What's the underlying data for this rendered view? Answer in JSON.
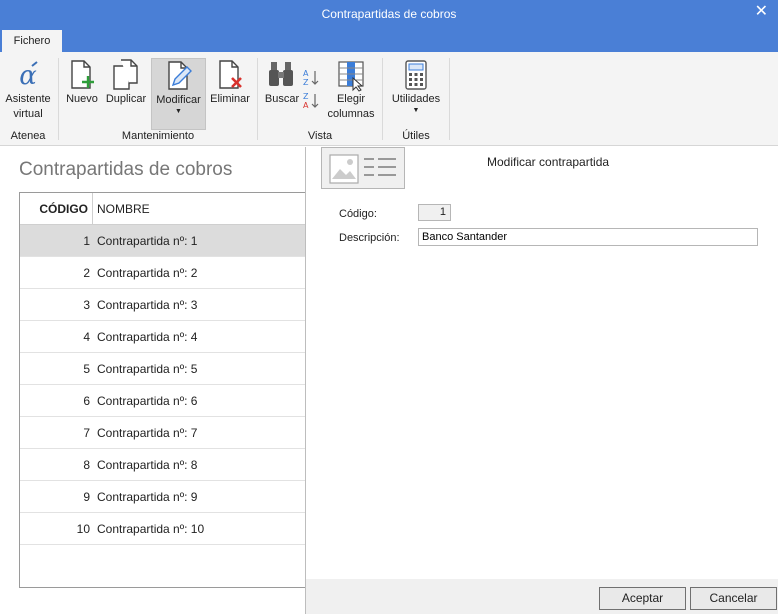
{
  "window": {
    "title": "Contrapartidas de cobros",
    "close_glyph": "✕"
  },
  "tabs": [
    {
      "label": "Fichero"
    }
  ],
  "ribbon": {
    "atenea": {
      "label": "Atenea",
      "asistente": "Asistente\nvirtual"
    },
    "mantenimiento": {
      "label": "Mantenimiento",
      "nuevo": "Nuevo",
      "duplicar": "Duplicar",
      "modificar": "Modificar",
      "eliminar": "Eliminar"
    },
    "vista": {
      "label": "Vista",
      "buscar": "Buscar",
      "elegir": "Elegir\ncolumnas"
    },
    "utiles": {
      "label": "Útiles",
      "utilidades": "Utilidades"
    }
  },
  "list": {
    "title": "Contrapartidas de cobros",
    "columns": {
      "code": "CÓDIGO",
      "name": "NOMBRE"
    },
    "rows": [
      {
        "code": "1",
        "name": "Contrapartida nº: 1"
      },
      {
        "code": "2",
        "name": "Contrapartida nº: 2"
      },
      {
        "code": "3",
        "name": "Contrapartida nº: 3"
      },
      {
        "code": "4",
        "name": "Contrapartida nº: 4"
      },
      {
        "code": "5",
        "name": "Contrapartida nº: 5"
      },
      {
        "code": "6",
        "name": "Contrapartida nº: 6"
      },
      {
        "code": "7",
        "name": "Contrapartida nº: 7"
      },
      {
        "code": "8",
        "name": "Contrapartida nº: 8"
      },
      {
        "code": "9",
        "name": "Contrapartida nº: 9"
      },
      {
        "code": "10",
        "name": "Contrapartida nº: 10"
      }
    ],
    "selected_index": 0
  },
  "form": {
    "title": "Modificar contrapartida",
    "code_label": "Código:",
    "code_value": "1",
    "desc_label": "Descripción:",
    "desc_value": "Banco Santander"
  },
  "buttons": {
    "accept": "Aceptar",
    "cancel": "Cancelar"
  },
  "colors": {
    "titlebar": "#4a7fd6",
    "ribbon_bg": "#f4f4f4",
    "selected_row": "#dcdcdc",
    "add_green": "#2e9e3a",
    "delete_red": "#d9322d",
    "accent_blue": "#3b7dd8"
  }
}
